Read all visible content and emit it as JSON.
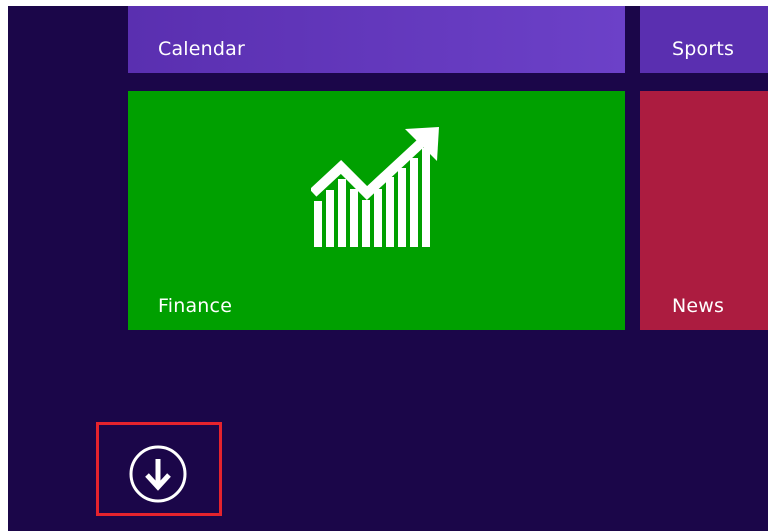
{
  "tiles": {
    "calendar": {
      "label": "Calendar",
      "color": "#5a2fb0"
    },
    "sports": {
      "label": "Sports",
      "color": "#5a2fb0"
    },
    "finance": {
      "label": "Finance",
      "color": "#00a000",
      "icon": "finance-chart-icon"
    },
    "news": {
      "label": "News",
      "color": "#ac1c40"
    }
  },
  "apps_button": {
    "icon": "down-arrow-circle-icon",
    "highlight_color": "#e5232d"
  },
  "colors": {
    "background": "#1b0649"
  }
}
